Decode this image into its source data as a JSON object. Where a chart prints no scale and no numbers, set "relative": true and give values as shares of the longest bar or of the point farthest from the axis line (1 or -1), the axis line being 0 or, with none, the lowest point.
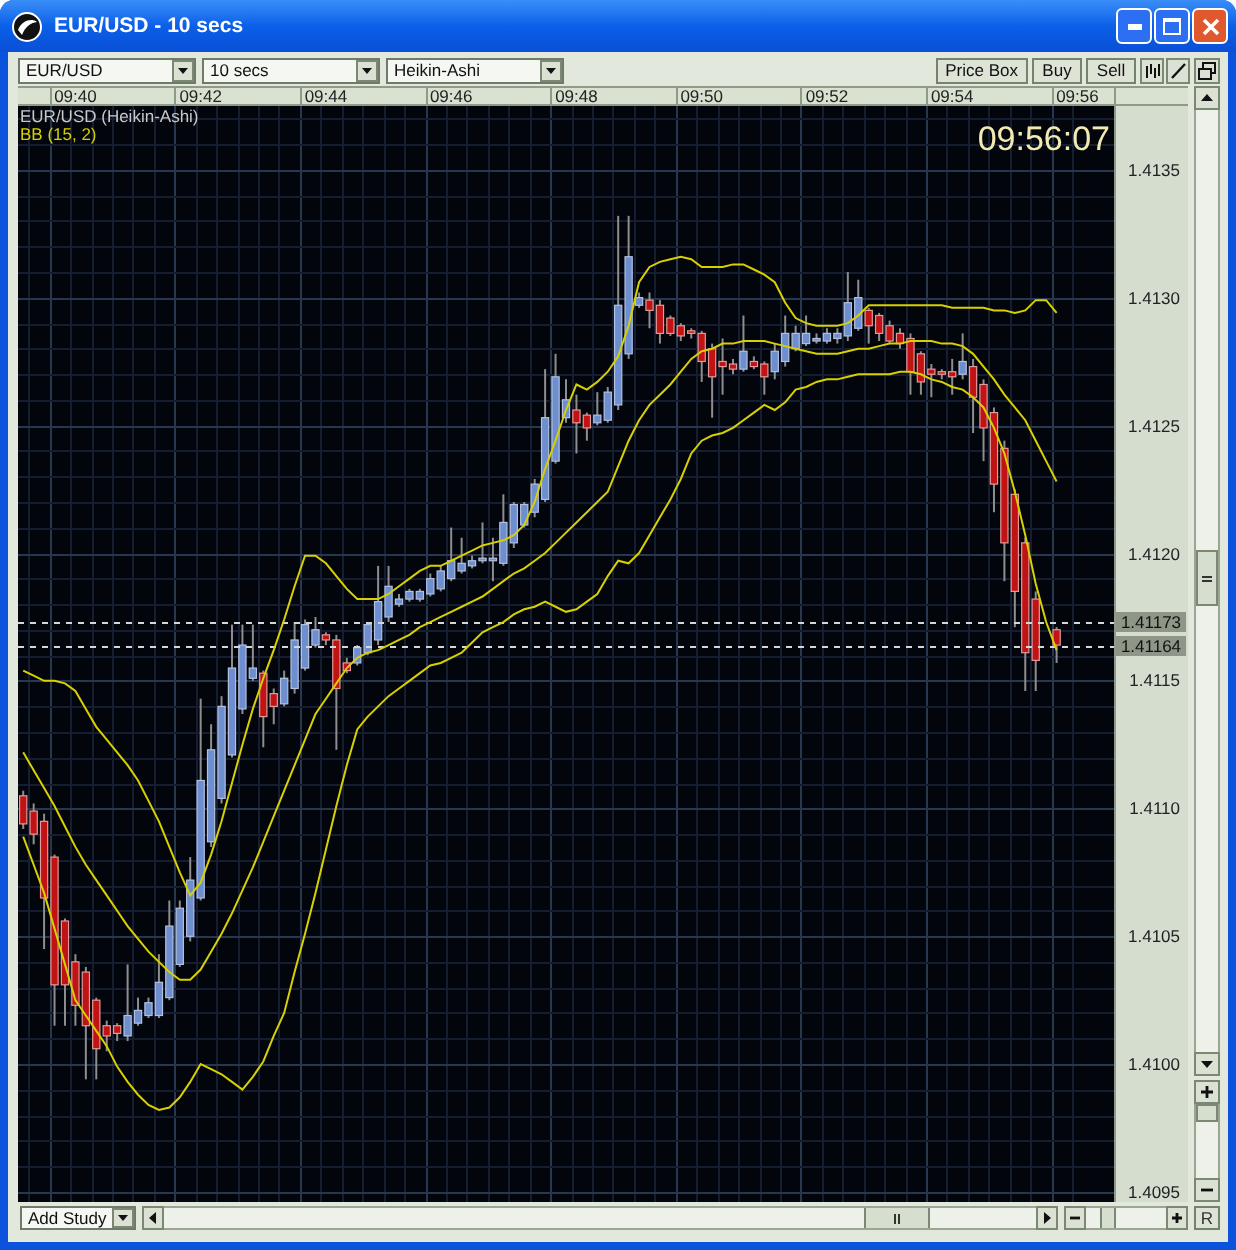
{
  "window": {
    "title": "EUR/USD - 10 secs"
  },
  "toolbar": {
    "selectors": [
      {
        "value": "EUR/USD"
      },
      {
        "value": "10 secs"
      },
      {
        "value": "Heikin-Ashi"
      }
    ],
    "buttons": [
      {
        "label": "Price Box"
      },
      {
        "label": "Buy"
      },
      {
        "label": "Sell"
      }
    ]
  },
  "chart": {
    "clock": "09:56:07",
    "chart_data": {
      "type": "candlestick",
      "title": "EUR/USD (Heikin-Ashi)",
      "grid": true,
      "categories": [
        null,
        null,
        null,
        null,
        null,
        "09:40",
        null,
        null,
        null,
        null,
        null,
        null,
        null,
        null,
        null,
        null,
        null,
        "09:42",
        null,
        null,
        null,
        null,
        null,
        null,
        null,
        null,
        null,
        null,
        null,
        "09:44",
        null,
        null,
        null,
        null,
        null,
        null,
        null,
        null,
        null,
        null,
        null,
        "09:46",
        null,
        null,
        null,
        null,
        null,
        null,
        null,
        null,
        null,
        null,
        null,
        "09:48",
        null,
        null,
        null,
        null,
        null,
        null,
        null,
        null,
        null,
        null,
        null,
        "09:50",
        null,
        null,
        null,
        null,
        null,
        null,
        null,
        null,
        null,
        null,
        null,
        "09:52",
        null,
        null,
        null,
        null,
        null,
        null,
        null,
        null,
        null,
        null,
        null,
        "09:54",
        null,
        null,
        null,
        null,
        null,
        null,
        null,
        null,
        null,
        null,
        null,
        "09:56",
        null,
        null,
        null
      ],
      "ylim": [
        1.40946,
        1.41375
      ],
      "yticks": [
        {
          "value": 1.4135,
          "label": "1.4135"
        },
        {
          "value": 1.413,
          "label": "1.4130"
        },
        {
          "value": 1.4125,
          "label": "1.4125"
        },
        {
          "value": 1.412,
          "label": "1.4120"
        },
        {
          "value": 1.4115,
          "label": "1.4115"
        },
        {
          "value": 1.411,
          "label": "1.4110"
        },
        {
          "value": 1.4105,
          "label": "1.4105"
        },
        {
          "value": 1.41,
          "label": "1.4100"
        },
        {
          "value": 1.4095,
          "label": "1.4095"
        }
      ],
      "ohlc": [
        [
          1.41105,
          1.41107,
          1.41092,
          1.41094
        ],
        [
          1.41099,
          1.41102,
          1.41086,
          1.4109
        ],
        [
          1.41095,
          1.41098,
          1.41045,
          1.41065
        ],
        [
          1.41081,
          1.41082,
          1.41015,
          1.41031
        ],
        [
          1.41056,
          1.41057,
          1.41015,
          1.41031
        ],
        [
          1.4104,
          1.41043,
          1.41015,
          1.41023
        ],
        [
          1.41036,
          1.41038,
          1.40994,
          1.41015
        ],
        [
          1.41025,
          1.41026,
          1.40994,
          1.41006
        ],
        [
          1.41015,
          1.41017,
          1.41005,
          1.41011
        ],
        [
          1.41015,
          1.41016,
          1.41009,
          1.41012
        ],
        [
          1.41011,
          1.41039,
          1.41009,
          1.41019
        ],
        [
          1.41016,
          1.41026,
          1.41015,
          1.41021
        ],
        [
          1.41019,
          1.41026,
          1.41018,
          1.41024
        ],
        [
          1.41019,
          1.41043,
          1.41018,
          1.41032
        ],
        [
          1.41026,
          1.41064,
          1.41025,
          1.41054
        ],
        [
          1.41039,
          1.41064,
          1.41038,
          1.41061
        ],
        [
          1.4105,
          1.41081,
          1.41048,
          1.41072
        ],
        [
          1.41065,
          1.41143,
          1.41064,
          1.41111
        ],
        [
          1.41087,
          1.41133,
          1.41085,
          1.41123
        ],
        [
          1.41104,
          1.41144,
          1.41102,
          1.4114
        ],
        [
          1.41121,
          1.41172,
          1.4112,
          1.41155
        ],
        [
          1.41139,
          1.41172,
          1.41137,
          1.41164
        ],
        [
          1.41151,
          1.41172,
          1.4115,
          1.41155
        ],
        [
          1.41153,
          1.41154,
          1.41124,
          1.41136
        ],
        [
          1.41145,
          1.41147,
          1.41133,
          1.4114
        ],
        [
          1.41141,
          1.41154,
          1.4114,
          1.41151
        ],
        [
          1.41147,
          1.41173,
          1.41145,
          1.41166
        ],
        [
          1.41155,
          1.41174,
          1.41154,
          1.41172
        ],
        [
          1.41164,
          1.41175,
          1.41163,
          1.4117
        ],
        [
          1.41168,
          1.41169,
          1.41164,
          1.41166
        ],
        [
          1.41166,
          1.41168,
          1.41123,
          1.41147
        ],
        [
          1.41157,
          1.41159,
          1.41153,
          1.41154
        ],
        [
          1.41157,
          1.41164,
          1.41156,
          1.41163
        ],
        [
          1.41161,
          1.41173,
          1.4116,
          1.41172
        ],
        [
          1.41166,
          1.41195,
          1.41164,
          1.41181
        ],
        [
          1.41175,
          1.41195,
          1.41173,
          1.41187
        ],
        [
          1.4118,
          1.41184,
          1.41179,
          1.41182
        ],
        [
          1.41182,
          1.41186,
          1.41181,
          1.41185
        ],
        [
          1.41182,
          1.41186,
          1.41181,
          1.41185
        ],
        [
          1.41184,
          1.41192,
          1.41183,
          1.4119
        ],
        [
          1.41186,
          1.41195,
          1.41185,
          1.41193
        ],
        [
          1.4119,
          1.4121,
          1.41189,
          1.41197
        ],
        [
          1.41193,
          1.41206,
          1.41192,
          1.41196
        ],
        [
          1.41195,
          1.41199,
          1.41194,
          1.41197
        ],
        [
          1.41197,
          1.41212,
          1.41196,
          1.41198
        ],
        [
          1.41197,
          1.41206,
          1.41189,
          1.41198
        ],
        [
          1.41196,
          1.41223,
          1.41195,
          1.41212
        ],
        [
          1.41204,
          1.4122,
          1.41202,
          1.41219
        ],
        [
          1.41211,
          1.4122,
          1.4121,
          1.41219
        ],
        [
          1.41216,
          1.41229,
          1.41214,
          1.41227
        ],
        [
          1.41221,
          1.41272,
          1.4122,
          1.41253
        ],
        [
          1.41236,
          1.41278,
          1.41235,
          1.41269
        ],
        [
          1.41253,
          1.41268,
          1.41251,
          1.4126
        ],
        [
          1.41256,
          1.41262,
          1.41239,
          1.41251
        ],
        [
          1.41254,
          1.41255,
          1.41244,
          1.41249
        ],
        [
          1.41251,
          1.41263,
          1.4125,
          1.41254
        ],
        [
          1.41252,
          1.41265,
          1.41251,
          1.41263
        ],
        [
          1.41258,
          1.41332,
          1.41256,
          1.41297
        ],
        [
          1.41278,
          1.41332,
          1.41276,
          1.41316
        ],
        [
          1.41297,
          1.41302,
          1.41296,
          1.413
        ],
        [
          1.41299,
          1.41302,
          1.41288,
          1.41295
        ],
        [
          1.41297,
          1.41299,
          1.41282,
          1.41286
        ],
        [
          1.41292,
          1.41293,
          1.41285,
          1.41286
        ],
        [
          1.41289,
          1.4129,
          1.41283,
          1.41285
        ],
        [
          1.41287,
          1.41288,
          1.41284,
          1.41286
        ],
        [
          1.41286,
          1.41287,
          1.41267,
          1.41275
        ],
        [
          1.4128,
          1.41282,
          1.41253,
          1.41269
        ],
        [
          1.41275,
          1.41284,
          1.41262,
          1.41273
        ],
        [
          1.41274,
          1.41276,
          1.4127,
          1.41272
        ],
        [
          1.41272,
          1.41293,
          1.41271,
          1.41279
        ],
        [
          1.41275,
          1.41277,
          1.41272,
          1.41273
        ],
        [
          1.41274,
          1.41275,
          1.41262,
          1.41269
        ],
        [
          1.41271,
          1.41282,
          1.41268,
          1.41279
        ],
        [
          1.41275,
          1.41293,
          1.41273,
          1.41286
        ],
        [
          1.4128,
          1.41289,
          1.41279,
          1.41286
        ],
        [
          1.41282,
          1.41293,
          1.41281,
          1.41286
        ],
        [
          1.41283,
          1.41286,
          1.41282,
          1.41284
        ],
        [
          1.41283,
          1.41288,
          1.41282,
          1.41286
        ],
        [
          1.41284,
          1.41288,
          1.41282,
          1.41286
        ],
        [
          1.41285,
          1.4131,
          1.41283,
          1.41298
        ],
        [
          1.41288,
          1.41307,
          1.41287,
          1.413
        ],
        [
          1.41295,
          1.41296,
          1.41282,
          1.41289
        ],
        [
          1.41293,
          1.41294,
          1.41283,
          1.41286
        ],
        [
          1.41289,
          1.41291,
          1.41282,
          1.41283
        ],
        [
          1.41286,
          1.41288,
          1.4128,
          1.41282
        ],
        [
          1.41284,
          1.41286,
          1.41262,
          1.41271
        ],
        [
          1.41278,
          1.41279,
          1.41262,
          1.41267
        ],
        [
          1.41272,
          1.41274,
          1.41261,
          1.4127
        ],
        [
          1.41271,
          1.41272,
          1.41268,
          1.4127
        ],
        [
          1.41271,
          1.41276,
          1.41262,
          1.41269
        ],
        [
          1.4127,
          1.41286,
          1.41268,
          1.41275
        ],
        [
          1.41273,
          1.41276,
          1.41247,
          1.41261
        ],
        [
          1.41266,
          1.41268,
          1.41236,
          1.41249
        ],
        [
          1.41255,
          1.41257,
          1.41216,
          1.41227
        ],
        [
          1.41241,
          1.41244,
          1.41189,
          1.41204
        ],
        [
          1.41223,
          1.41225,
          1.41171,
          1.41185
        ],
        [
          1.41204,
          1.41206,
          1.41146,
          1.41161
        ],
        [
          1.41182,
          1.41185,
          1.41146,
          1.41158
        ],
        null,
        [
          1.4117,
          1.41171,
          1.41157,
          1.41164
        ],
        null,
        null,
        null,
        null,
        null
      ],
      "ref_lines": [
        {
          "axis": "y",
          "value": 1.41173,
          "label": "1.41173"
        },
        {
          "axis": "y",
          "value": 1.41164,
          "label": "1.41164"
        }
      ]
    },
    "indicator": {
      "chart_data": {
        "type": "line",
        "title": "BB (15, 2)",
        "relative": true,
        "categories": [
          null,
          null,
          null,
          null,
          null,
          null,
          null,
          null,
          null,
          null,
          null,
          null,
          null,
          null,
          null,
          null,
          null,
          null,
          null,
          null,
          null,
          null,
          null,
          null,
          null,
          null,
          null,
          null,
          null,
          null,
          null,
          null,
          null,
          null,
          null,
          null,
          null,
          null,
          null,
          null,
          null,
          null,
          null,
          null,
          null,
          null,
          null,
          null,
          null,
          null,
          null,
          null,
          null,
          null,
          null,
          null,
          null,
          null,
          null,
          null,
          null,
          null,
          null,
          null,
          null,
          null,
          null,
          null,
          null,
          null,
          null,
          null,
          null,
          null,
          null,
          null,
          null,
          null,
          null,
          null,
          null,
          null,
          null,
          null,
          null,
          null,
          null,
          null,
          null,
          null,
          null,
          null,
          null,
          null,
          null,
          null,
          null,
          null,
          null,
          null,
          null,
          null,
          null,
          null,
          null
        ],
        "ylim": [
          1.40946,
          1.41375
        ],
        "series": [
          {
            "color": "#d8d000",
            "values": [
              1.41154,
              1.41152,
              1.4115,
              1.4115,
              1.41149,
              1.41146,
              1.41139,
              1.41132,
              1.41127,
              1.41122,
              1.41117,
              1.41111,
              1.41103,
              1.41095,
              1.41085,
              1.41075,
              1.41066,
              1.41071,
              1.41082,
              1.41095,
              1.4111,
              1.41125,
              1.41139,
              1.41151,
              1.41162,
              1.41174,
              1.41187,
              1.41199,
              1.41199,
              1.41196,
              1.41191,
              1.41186,
              1.41182,
              1.41182,
              1.41182,
              1.41184,
              1.41187,
              1.4119,
              1.41193,
              1.41195,
              1.41195,
              1.41197,
              1.41199,
              1.41201,
              1.41203,
              1.41204,
              1.41205,
              1.41207,
              1.41211,
              1.4122,
              1.41233,
              1.41244,
              1.41256,
              1.41266,
              1.41264,
              1.41267,
              1.41271,
              1.41277,
              1.41289,
              1.41306,
              1.41312,
              1.41314,
              1.41315,
              1.41316,
              1.41315,
              1.41312,
              1.41312,
              1.41312,
              1.41313,
              1.41313,
              1.41311,
              1.41309,
              1.41306,
              1.41298,
              1.41292,
              1.4129,
              1.41289,
              1.41289,
              1.41289,
              1.4129,
              1.41293,
              1.41297,
              1.41297,
              1.41297,
              1.41297,
              1.41297,
              1.41297,
              1.41297,
              1.41297,
              1.41296,
              1.41296,
              1.41296,
              1.41296,
              1.41295,
              1.41295,
              1.41294,
              1.41295,
              1.41299,
              1.41299,
              1.41294,
              null,
              null,
              null,
              null,
              null
            ]
          },
          {
            "color": "#d8d000",
            "values": [
              1.41122,
              1.41115,
              1.41108,
              1.41101,
              1.41093,
              1.41085,
              1.41078,
              1.41072,
              1.41066,
              1.4106,
              1.41054,
              1.41049,
              1.41044,
              1.4104,
              1.41036,
              1.41033,
              1.41033,
              1.41037,
              1.41044,
              1.41051,
              1.41059,
              1.41068,
              1.41077,
              1.41087,
              1.41097,
              1.41107,
              1.41117,
              1.41127,
              1.41137,
              1.41143,
              1.41149,
              1.41155,
              1.41159,
              1.41161,
              1.41162,
              1.41164,
              1.41166,
              1.41168,
              1.41171,
              1.41173,
              1.41175,
              1.41177,
              1.41179,
              1.41181,
              1.41183,
              1.41186,
              1.41189,
              1.41192,
              1.41194,
              1.41197,
              1.412,
              1.41204,
              1.41208,
              1.41212,
              1.41216,
              1.4122,
              1.41224,
              1.41234,
              1.41244,
              1.41252,
              1.41258,
              1.41262,
              1.41266,
              1.41271,
              1.41276,
              1.41279,
              1.4128,
              1.41282,
              1.41282,
              1.41283,
              1.41283,
              1.41283,
              1.41282,
              1.41281,
              1.4128,
              1.41279,
              1.41278,
              1.41278,
              1.41278,
              1.41279,
              1.4128,
              1.4128,
              1.41281,
              1.41282,
              1.41282,
              1.41283,
              1.41283,
              1.41283,
              1.41282,
              1.41282,
              1.41281,
              1.41278,
              1.41273,
              1.41268,
              1.41262,
              1.41257,
              1.41252,
              1.41244,
              1.41236,
              1.41228,
              null,
              null,
              null,
              null,
              null
            ]
          },
          {
            "color": "#d8d000",
            "values": [
              1.41089,
              1.41078,
              1.41067,
              1.41053,
              1.41039,
              1.41025,
              1.41019,
              1.41013,
              1.41007,
              1.40999,
              1.40993,
              1.40988,
              1.40984,
              1.40982,
              1.40983,
              1.40987,
              1.40993,
              1.41,
              1.40998,
              1.40996,
              1.40993,
              1.4099,
              1.40995,
              1.41001,
              1.41011,
              1.4102,
              1.41036,
              1.41051,
              1.41067,
              1.41084,
              1.41101,
              1.41117,
              1.41131,
              1.41136,
              1.4114,
              1.41144,
              1.41147,
              1.4115,
              1.41153,
              1.41156,
              1.41157,
              1.41159,
              1.41161,
              1.41165,
              1.41169,
              1.41171,
              1.41173,
              1.41176,
              1.41178,
              1.41179,
              1.41181,
              1.41179,
              1.41177,
              1.41178,
              1.41181,
              1.41184,
              1.41191,
              1.41197,
              1.41196,
              1.412,
              1.41207,
              1.41214,
              1.41221,
              1.41229,
              1.41239,
              1.41244,
              1.41246,
              1.41247,
              1.41249,
              1.41252,
              1.41255,
              1.41258,
              1.41256,
              1.41259,
              1.41264,
              1.41265,
              1.41267,
              1.41268,
              1.41268,
              1.41269,
              1.4127,
              1.4127,
              1.4127,
              1.4127,
              1.41271,
              1.41271,
              1.4127,
              1.41268,
              1.41267,
              1.41265,
              1.41264,
              1.41261,
              1.41257,
              1.41249,
              1.41239,
              1.41224,
              1.41207,
              1.41188,
              1.41173,
              1.41162,
              null,
              null,
              null,
              null,
              null
            ]
          }
        ]
      }
    }
  },
  "bottom_bar": {
    "study_selector": {
      "value": "Add Study"
    },
    "reset_button": {
      "label": "R"
    }
  }
}
